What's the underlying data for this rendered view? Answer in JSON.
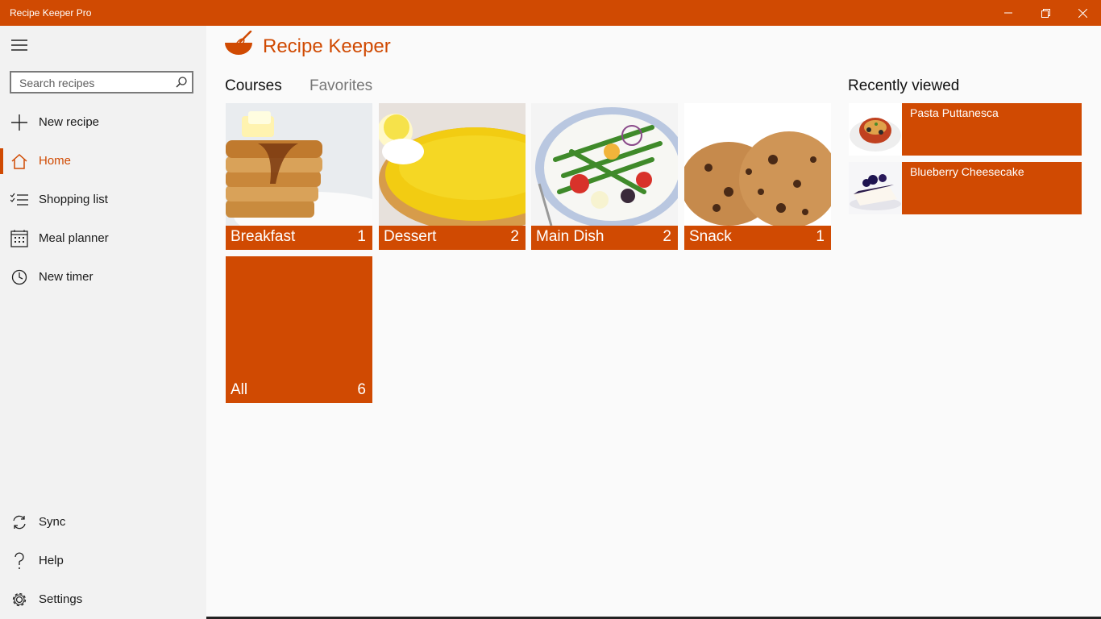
{
  "window": {
    "title": "Recipe Keeper Pro",
    "accent": "#d04a02",
    "controls": [
      "minimize-icon",
      "restore-icon",
      "close-icon"
    ]
  },
  "sidebar": {
    "search_placeholder": "Search recipes",
    "items": [
      {
        "label": "New recipe",
        "icon": "plus-icon"
      },
      {
        "label": "Home",
        "icon": "home-icon",
        "active": true
      },
      {
        "label": "Shopping list",
        "icon": "list-icon"
      },
      {
        "label": "Meal planner",
        "icon": "calendar-icon"
      },
      {
        "label": "New timer",
        "icon": "clock-icon"
      }
    ],
    "bottom_items": [
      {
        "label": "Sync",
        "icon": "sync-icon"
      },
      {
        "label": "Help",
        "icon": "help-icon"
      },
      {
        "label": "Settings",
        "icon": "gear-icon"
      }
    ]
  },
  "header": {
    "app_name": "Recipe Keeper"
  },
  "tabs": [
    {
      "label": "Courses",
      "selected": true
    },
    {
      "label": "Favorites",
      "selected": false
    }
  ],
  "courses": [
    {
      "label": "Breakfast",
      "count": "1",
      "image": "pancakes"
    },
    {
      "label": "Dessert",
      "count": "2",
      "image": "lemon tart"
    },
    {
      "label": "Main Dish",
      "count": "2",
      "image": "salad"
    },
    {
      "label": "Snack",
      "count": "1",
      "image": "cookies"
    },
    {
      "label": "All",
      "count": "6"
    }
  ],
  "recent": {
    "title": "Recently viewed",
    "items": [
      {
        "label": "Pasta Puttanesca",
        "image": "pasta"
      },
      {
        "label": "Blueberry Cheesecake",
        "image": "cheesecake"
      }
    ]
  }
}
